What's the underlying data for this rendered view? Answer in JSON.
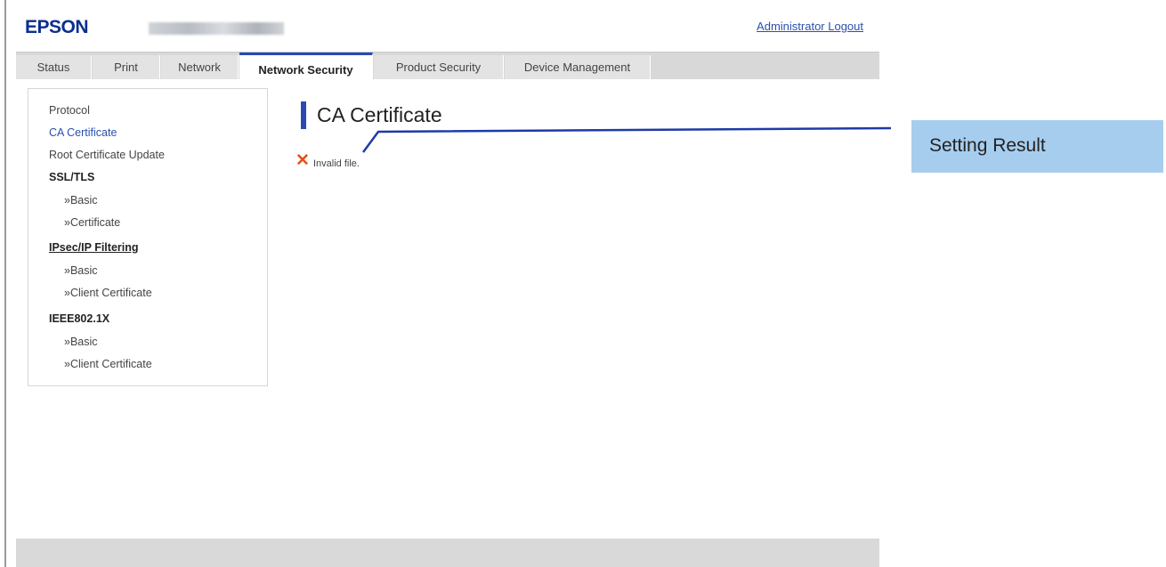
{
  "header": {
    "logo": "EPSON",
    "logout_label": "Administrator Logout"
  },
  "tabs": [
    {
      "label": "Status"
    },
    {
      "label": "Print"
    },
    {
      "label": "Network"
    },
    {
      "label": "Network Security",
      "active": true
    },
    {
      "label": "Product Security"
    },
    {
      "label": "Device Management"
    }
  ],
  "sidebar": {
    "protocol": "Protocol",
    "ca_certificate": "CA Certificate",
    "root_update": "Root Certificate Update",
    "ssl_heading": "SSL/TLS",
    "ssl_basic": "»Basic",
    "ssl_certificate": "»Certificate",
    "ipsec_heading": "IPsec/IP Filtering",
    "ipsec_basic": "»Basic",
    "ipsec_client": "»Client Certificate",
    "ieee_heading": "IEEE802.1X",
    "ieee_basic": "»Basic",
    "ieee_client": "»Client Certificate"
  },
  "main": {
    "title": "CA Certificate",
    "error_icon": "✕",
    "message": "Invalid file."
  },
  "callout": {
    "label": "Setting Result"
  },
  "colors": {
    "accent": "#2a49b5",
    "link": "#2a4fb0",
    "error": "#e2531f",
    "callout_bg": "#a7cdee",
    "tabbar_bg": "#d8d8d8"
  }
}
